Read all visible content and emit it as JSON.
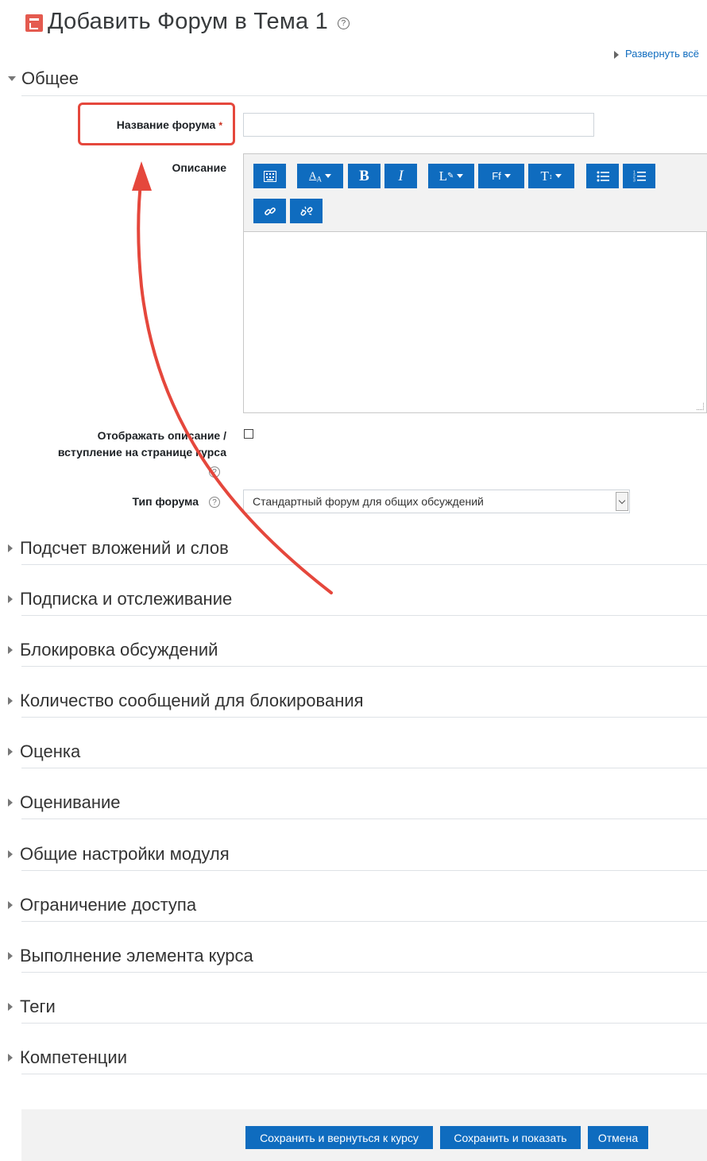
{
  "header": {
    "title": "Добавить Форум в Тема 1",
    "help_glyph": "?",
    "expand_all": "Развернуть всё"
  },
  "general": {
    "title": "Общее",
    "forum_name_label": "Название форума",
    "required_mark": "*",
    "forum_name_value": "",
    "description_label": "Описание",
    "show_description_label_line1": "Отображать описание /",
    "show_description_label_line2": "вступление на странице курса",
    "show_description_checked": false,
    "forum_type_label": "Тип форума",
    "forum_type_value": "Стандартный форум для общих обсуждений",
    "help_glyph": "?"
  },
  "editor_toolbar": [
    {
      "icon": "keyboard-icon",
      "label": "▦",
      "dropdown": false
    },
    {
      "icon": "font-size-icon",
      "label": "A",
      "dropdown": true
    },
    {
      "icon": "bold-icon",
      "label": "B",
      "dropdown": false
    },
    {
      "icon": "italic-icon",
      "label": "I",
      "dropdown": false
    },
    {
      "icon": "paragraph-style-icon",
      "label": "L",
      "dropdown": true
    },
    {
      "icon": "font-family-icon",
      "label": "Ff",
      "dropdown": true
    },
    {
      "icon": "text-style-icon",
      "label": "T",
      "dropdown": true
    },
    {
      "icon": "unordered-list-icon",
      "label": "☰",
      "dropdown": false
    },
    {
      "icon": "ordered-list-icon",
      "label": "☰",
      "dropdown": false
    },
    {
      "icon": "link-icon",
      "label": "🔗",
      "dropdown": false
    },
    {
      "icon": "unlink-icon",
      "label": "⛓",
      "dropdown": false
    }
  ],
  "sections": [
    "Подсчет вложений и слов",
    "Подписка и отслеживание",
    "Блокировка обсуждений",
    "Количество сообщений для блокирования",
    "Оценка",
    "Оценивание",
    "Общие настройки модуля",
    "Ограничение доступа",
    "Выполнение элемента курса",
    "Теги",
    "Компетенции"
  ],
  "footer": {
    "save_return": "Сохранить и вернуться к курсу",
    "save_display": "Сохранить и показать",
    "cancel": "Отмена"
  },
  "colors": {
    "accent": "#0f6cbf",
    "annotation": "#e5473c",
    "required": "#ca3120"
  }
}
